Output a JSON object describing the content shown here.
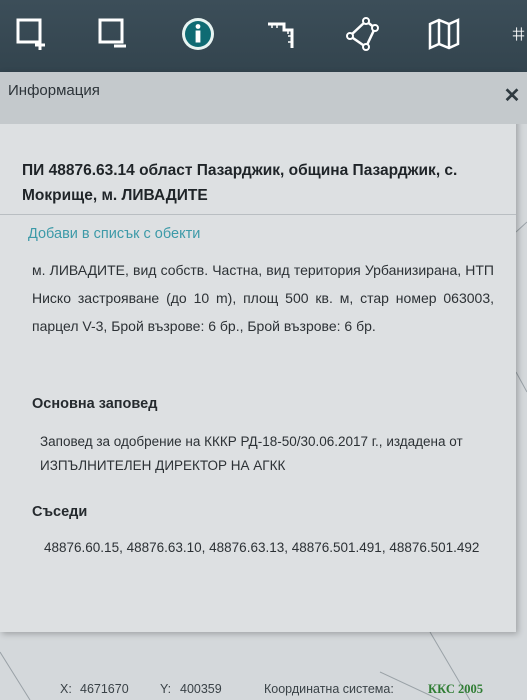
{
  "toolbar": {
    "tools": [
      {
        "icon": "select-rectangle-icon"
      },
      {
        "icon": "select-rectangle-alt-icon"
      },
      {
        "icon": "info-icon",
        "active": true
      },
      {
        "icon": "measure-distance-icon"
      },
      {
        "icon": "draw-polygon-icon"
      },
      {
        "icon": "map-layers-icon"
      },
      {
        "icon": "more-tools-icon"
      }
    ],
    "active_color": "#0f6b73"
  },
  "panel": {
    "title": "Информация",
    "heading": "ПИ 48876.63.14 област Пазарджик, община Пазарджик, с. Мокрище, м. ЛИВАДИТЕ",
    "add_link": "Добави в списък с обекти",
    "description": "м. ЛИВАДИТЕ, вид собств. Частна, вид територия Урбанизирана, НТП Ниско застрояване (до 10 m), площ 500 кв. м, стар номер 063003, парцел V-3, Брой възрове: 6 бр., Брой възрове: 6 бр.",
    "order": {
      "title": "Основна заповед",
      "text": "Заповед за одобрение на КККР РД-18-50/30.06.2017 г., издадена от ИЗПЪЛНИТЕЛЕН ДИРЕКТОР НА АГКК"
    },
    "neighbors": {
      "title": "Съседи",
      "list": "48876.60.15,  48876.63.10,  48876.63.13,  48876.501.491,  48876.501.492"
    }
  },
  "status": {
    "x_label": "X:",
    "x_value": "4671670",
    "y_label": "Y:",
    "y_value": "400359",
    "crs_label": "Координатна система:",
    "crs_value": "ККС 2005"
  },
  "colors": {
    "link": "#3d9aa8",
    "crs": "#2f7d33"
  }
}
